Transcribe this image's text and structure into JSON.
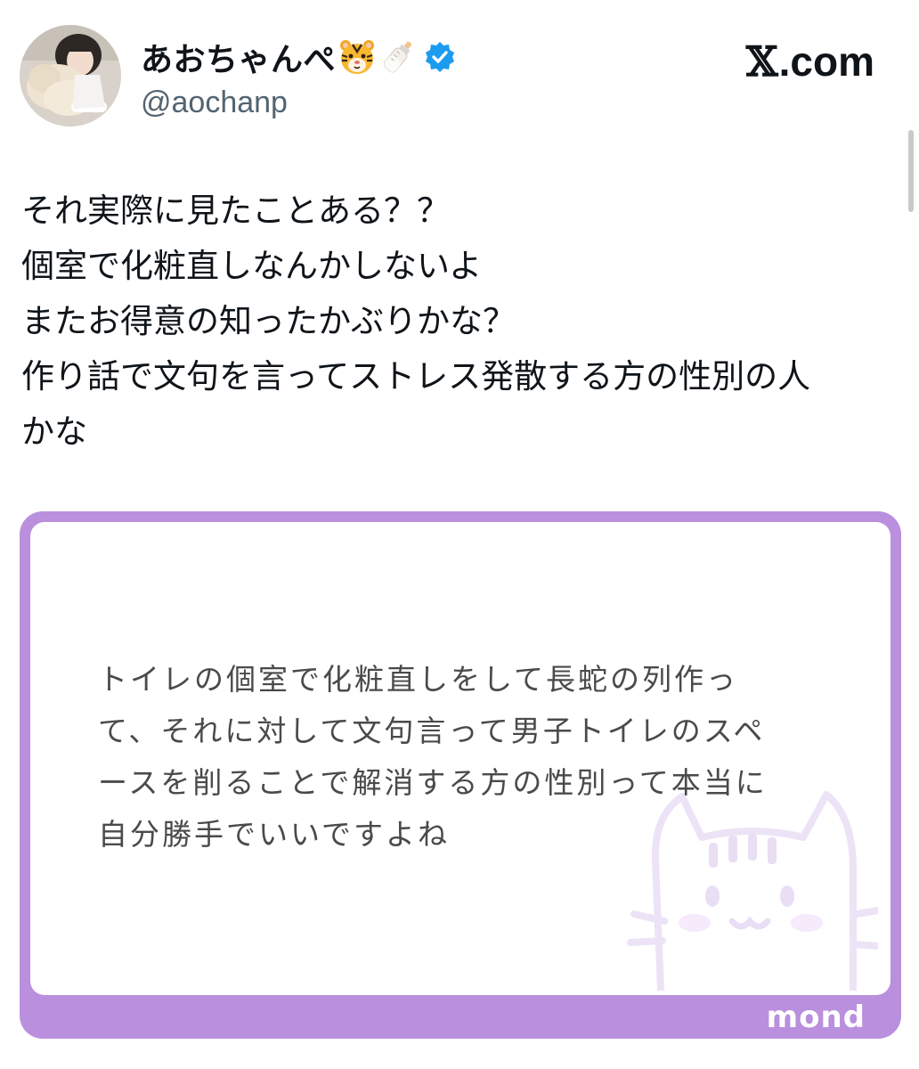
{
  "author": {
    "display_name": "あおちゃんぺ",
    "handle": "@aochanp",
    "avatar_icon": "profile-photo",
    "badges": [
      "tiger-face-icon",
      "baby-bottle-icon",
      "verified-badge-icon"
    ],
    "verified_color": "#1d9bf0"
  },
  "brand": {
    "label": "X.com",
    "x_glyph": "𝕏",
    "suffix": ".com"
  },
  "tweet": {
    "lines": [
      "それ実際に見たことある？？",
      "個室で化粧直しなんかしないよ",
      "またお得意の知ったかぶりかな？",
      "作り話で文句を言ってストレス発散する方の性別の人",
      "かな"
    ]
  },
  "card": {
    "lines": [
      "トイレの個室で化粧直しをして長蛇の列作っ",
      "て、それに対して文句言って男子トイレのスペ",
      "ースを削ることで解消する方の性別って本当に",
      "自分勝手でいいですよね"
    ],
    "logo": "mond",
    "border_color": "#b98fde",
    "watermark_icon": "cat-face-icon"
  }
}
